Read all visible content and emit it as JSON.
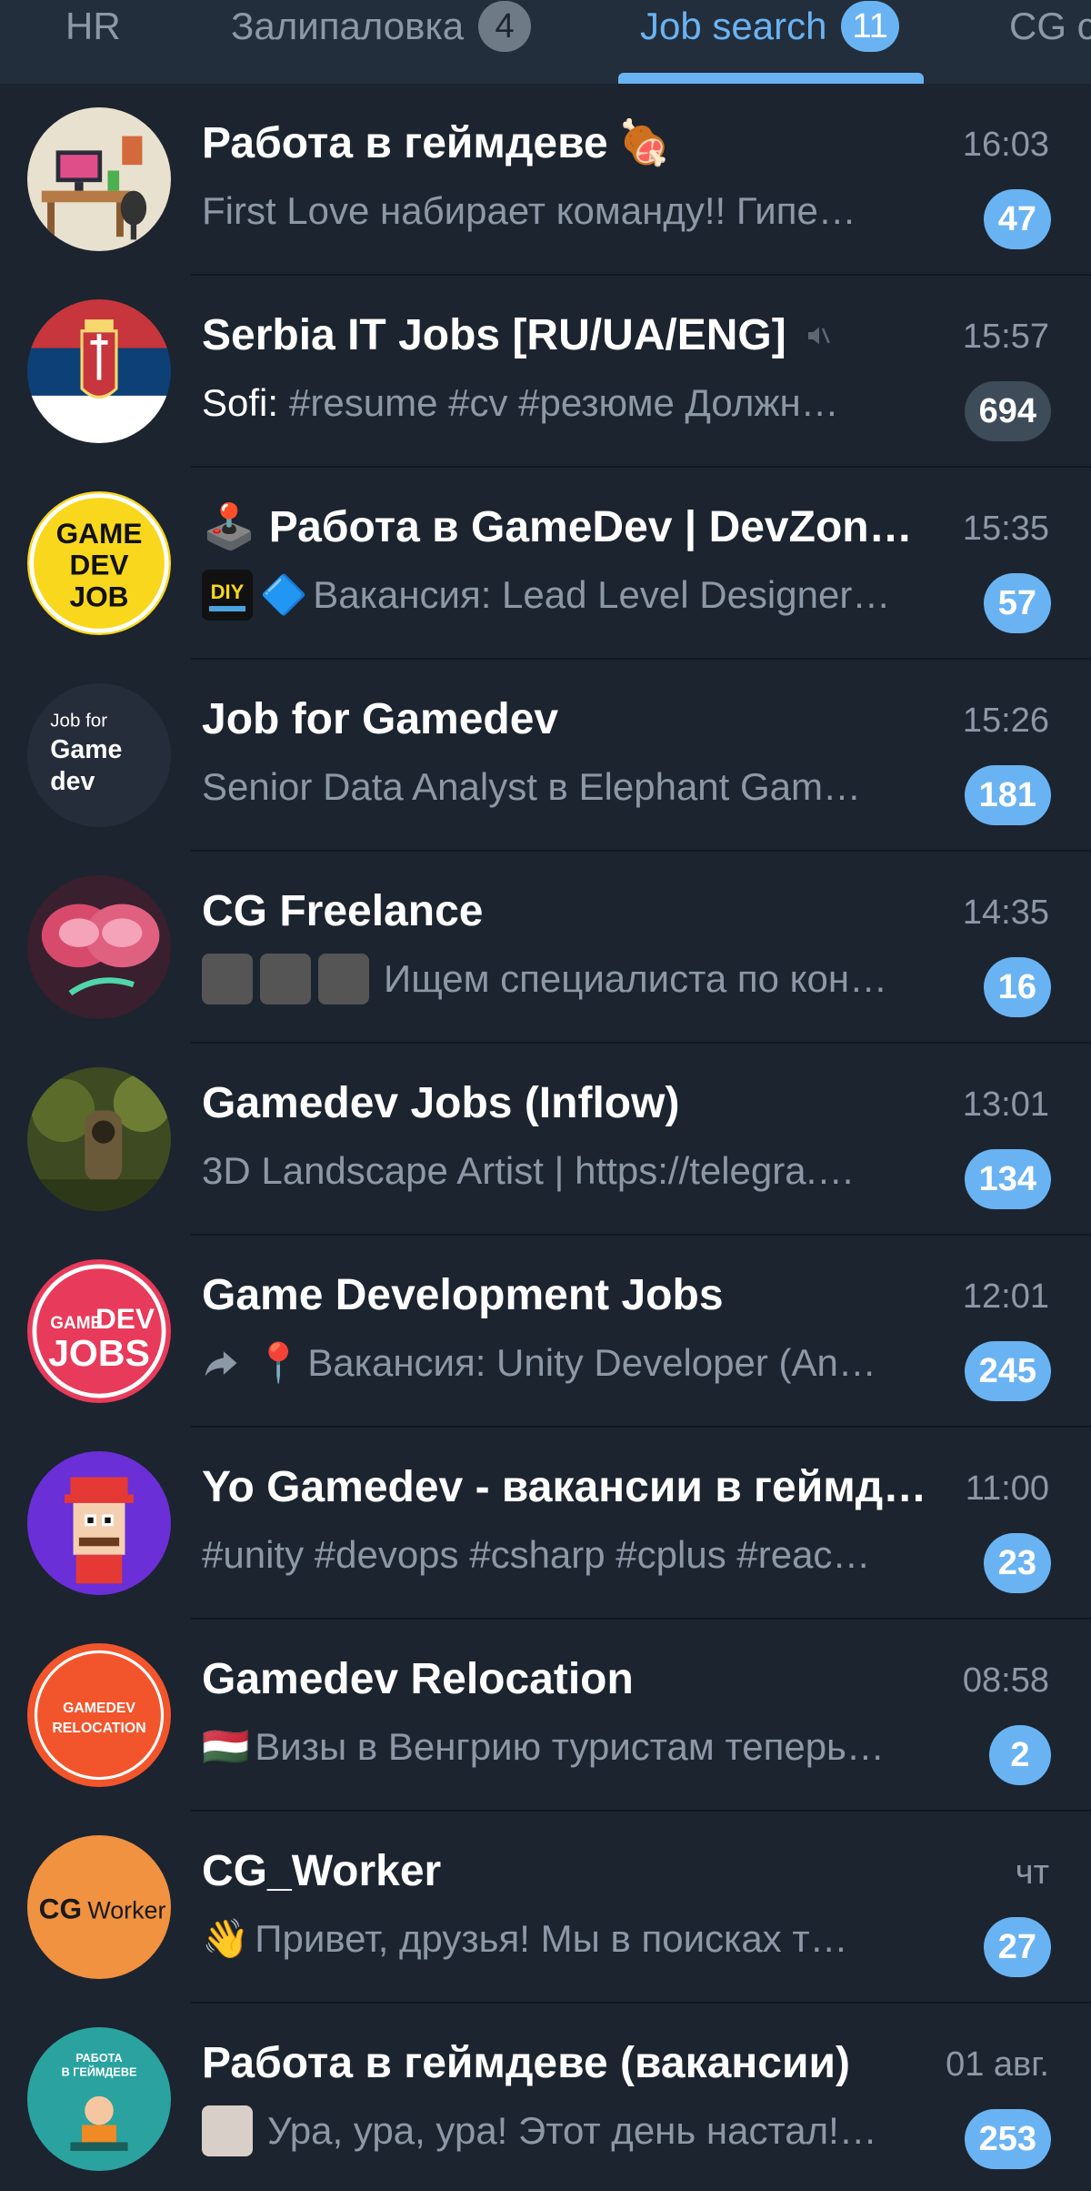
{
  "tabs": [
    {
      "label": "HR",
      "badge": null
    },
    {
      "label": "Залипаловка",
      "badge": "4"
    },
    {
      "label": "Job search",
      "badge": "11",
      "active": true
    },
    {
      "label": "CG c",
      "badge": null
    }
  ],
  "colors": {
    "accent": "#6ab3f3",
    "background": "#1c242f",
    "header": "#232e3c",
    "muted_text": "#8d98a6"
  },
  "chats": [
    {
      "title": "Работа в геймдеве",
      "title_emoji": "🍖",
      "time": "16:03",
      "preview": "First Love набирает команду!!    Гипе…",
      "unread": "47",
      "icon": "workspace-avatar"
    },
    {
      "title": "Serbia IT Jobs [RU/UA/ENG]",
      "muted": true,
      "time": "15:57",
      "sender": "Sofi:",
      "preview": "#resume #cv #резюме  Должн…",
      "unread": "694",
      "icon": "serbia-flag-avatar"
    },
    {
      "title": "Работа в GameDev | DevZone…",
      "title_prefix": "🕹️",
      "time": "15:35",
      "preview_prefix": "🔷",
      "preview": "Вакансия: Lead Level Designer…",
      "unread": "57",
      "icon": "game-dev-job-avatar",
      "thumb": "diy-projects"
    },
    {
      "title": "Job for Gamedev",
      "time": "15:26",
      "preview": "Senior Data Analyst в Elephant Gam…",
      "unread": "181",
      "icon": "job-for-gamedev-avatar"
    },
    {
      "title": "CG Freelance",
      "time": "14:35",
      "preview": "Ищем специалиста по кон…",
      "unread": "16",
      "icon": "cg-freelance-avatar",
      "thumbs": 3
    },
    {
      "title": "Gamedev Jobs (Inflow)",
      "time": "13:01",
      "preview": "3D Landscape Artist | https://telegra.…",
      "unread": "134",
      "icon": "forest-avatar"
    },
    {
      "title": "Game Development Jobs",
      "time": "12:01",
      "preview_prefix": "📍",
      "preview": "Вакансия: Unity Developer (An…",
      "unread": "245",
      "icon": "gamedev-jobs-avatar",
      "forwarded": true
    },
    {
      "title": "Yo Gamedev - вакансии в геймд…",
      "time": "11:00",
      "preview": "#unity #devops #csharp #cplus #reac…",
      "unread": "23",
      "icon": "pixel-character-avatar"
    },
    {
      "title": "Gamedev Relocation",
      "time": "08:58",
      "preview_prefix": "🇭🇺",
      "preview": "Визы в Венгрию туристам теперь…",
      "unread": "2",
      "icon": "gamedev-relocation-avatar"
    },
    {
      "title": "CG_Worker",
      "time": "чт",
      "preview_prefix": "👋",
      "preview": "Привет, друзья!  Мы в поисках т…",
      "unread": "27",
      "icon": "cg-worker-avatar"
    },
    {
      "title": "Работа в геймдеве (вакансии)",
      "time": "01 авг.",
      "preview": "Ура, ура, ура! Этот день настал!…",
      "unread": "253",
      "icon": "work-gamedev-avatar",
      "thumb": "picture"
    }
  ],
  "avatar_text": {
    "game_dev_job": [
      "GAME",
      "DEV",
      "JOB"
    ],
    "job_for_gamedev": [
      "Job for",
      "Game",
      "dev"
    ],
    "gamedev_jobs": [
      "GAME",
      "DEV",
      "JOBS"
    ],
    "gamedev_relocation": [
      "GAMEDEV",
      "RELOCATION"
    ],
    "cg_worker": [
      "CG",
      "Worker"
    ],
    "work_gamedev": [
      "РАБОТА",
      "В ГЕЙМДЕВЕ"
    ],
    "diy": "DIY"
  }
}
